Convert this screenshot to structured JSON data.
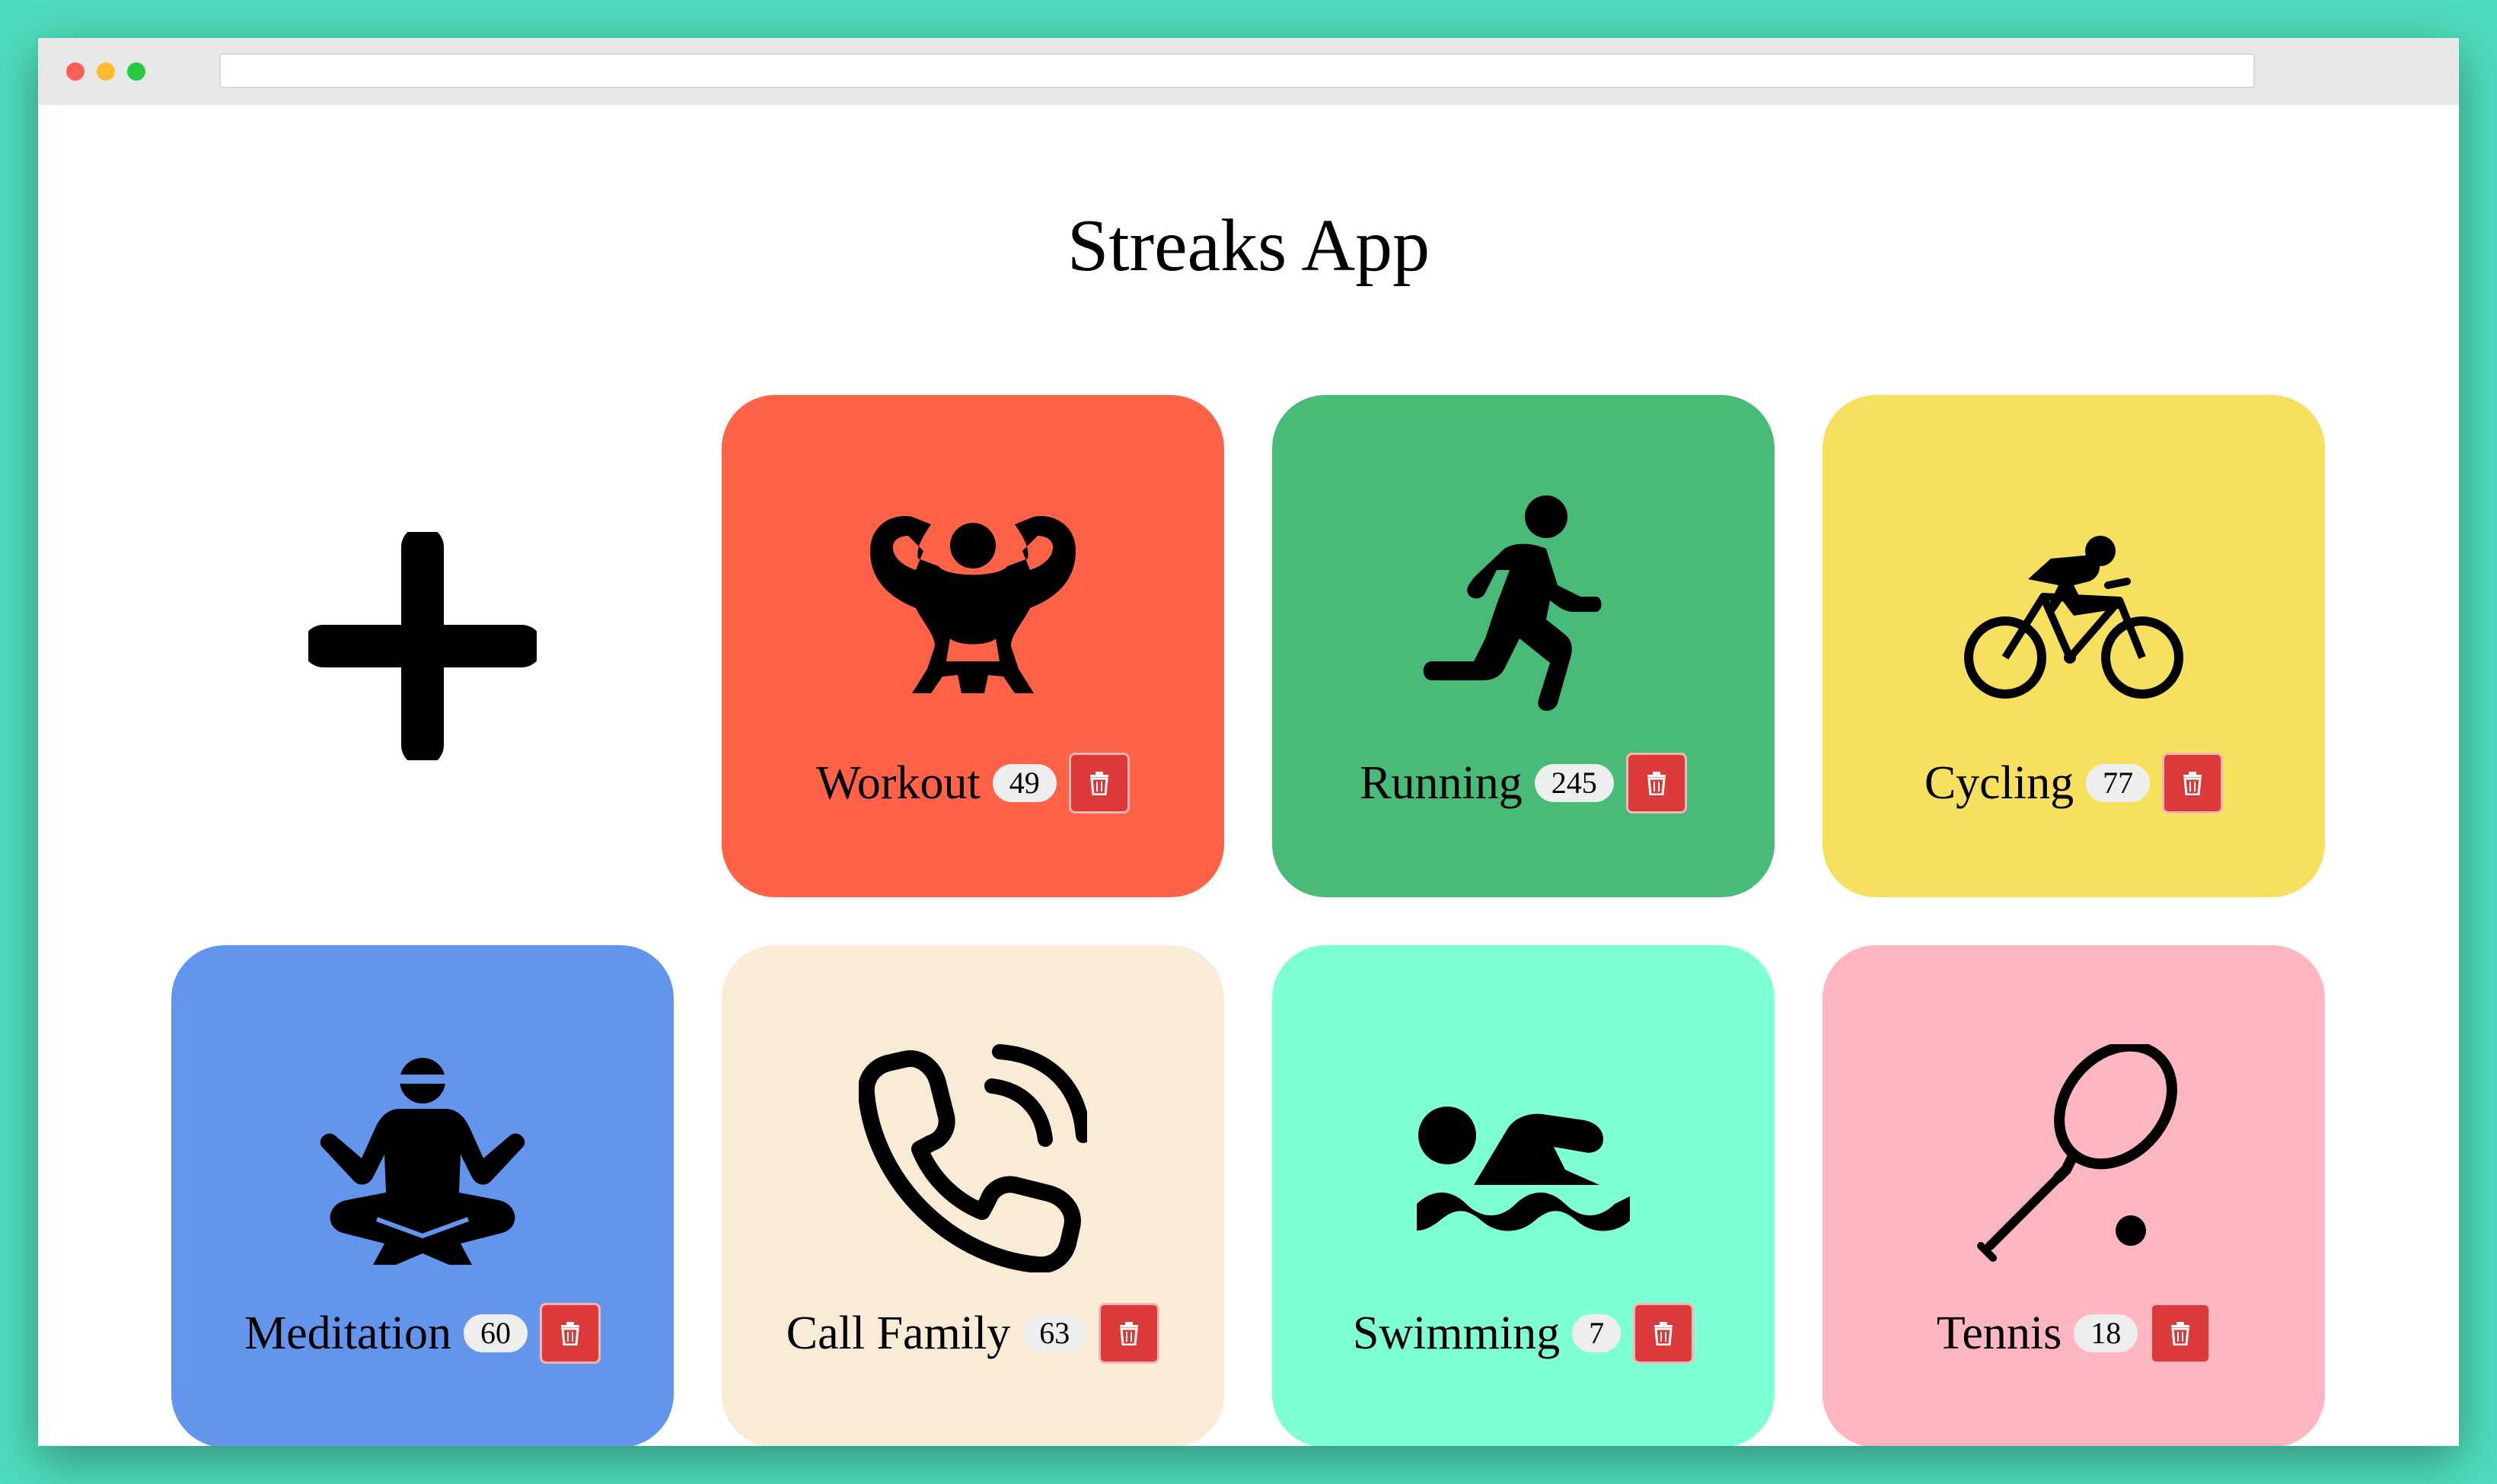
{
  "app": {
    "title": "Streaks App"
  },
  "add_card": {
    "icon": "plus-icon"
  },
  "streaks": [
    {
      "name": "Workout",
      "count": "49",
      "color": "#ff6347",
      "icon": "bodybuilder-icon"
    },
    {
      "name": "Running",
      "count": "245",
      "color": "#48bb78",
      "icon": "running-person-icon"
    },
    {
      "name": "Cycling",
      "count": "77",
      "color": "#f6e05e",
      "icon": "cyclist-icon"
    },
    {
      "name": "Meditation",
      "count": "60",
      "color": "#6495ed",
      "icon": "meditation-icon"
    },
    {
      "name": "Call Family",
      "count": "63",
      "color": "#faebd7",
      "icon": "phone-call-icon"
    },
    {
      "name": "Swimming",
      "count": "7",
      "color": "#7fffd4",
      "icon": "swimmer-icon"
    },
    {
      "name": "Tennis",
      "count": "18",
      "color": "#ffb6c1",
      "icon": "tennis-racket-icon"
    }
  ],
  "delete_icon": "trash-icon"
}
